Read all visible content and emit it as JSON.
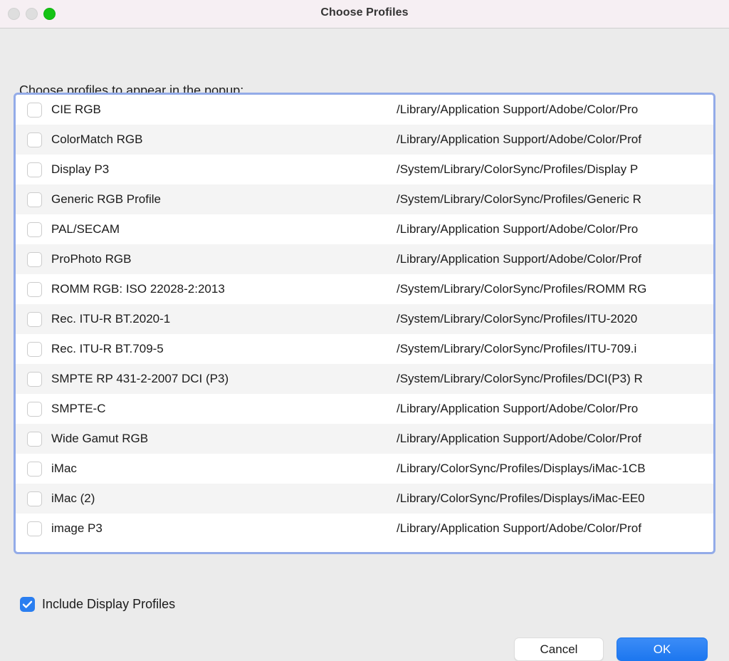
{
  "window": {
    "title": "Choose Profiles",
    "traffic_lights": [
      {
        "name": "close-button",
        "color": "#dedede"
      },
      {
        "name": "minimize-button",
        "color": "#dedede"
      },
      {
        "name": "zoom-button",
        "color": "#14c314"
      }
    ]
  },
  "prompt": "Choose profiles to appear in the popup:",
  "list": {
    "focus_ring_color": "#93abe8",
    "rows": [
      {
        "checked": false,
        "name": "CIE RGB",
        "path": "/Library/Application Support/Adobe/Color/Pro"
      },
      {
        "checked": false,
        "name": "ColorMatch RGB",
        "path": "/Library/Application Support/Adobe/Color/Prof"
      },
      {
        "checked": false,
        "name": "Display P3",
        "path": "/System/Library/ColorSync/Profiles/Display P"
      },
      {
        "checked": false,
        "name": "Generic RGB Profile",
        "path": "/System/Library/ColorSync/Profiles/Generic R"
      },
      {
        "checked": false,
        "name": "PAL/SECAM",
        "path": "/Library/Application Support/Adobe/Color/Pro"
      },
      {
        "checked": false,
        "name": "ProPhoto RGB",
        "path": "/Library/Application Support/Adobe/Color/Prof"
      },
      {
        "checked": false,
        "name": "ROMM RGB: ISO 22028-2:2013",
        "path": "/System/Library/ColorSync/Profiles/ROMM RG"
      },
      {
        "checked": false,
        "name": "Rec. ITU-R BT.2020-1",
        "path": "/System/Library/ColorSync/Profiles/ITU-2020"
      },
      {
        "checked": false,
        "name": "Rec. ITU-R BT.709-5",
        "path": "/System/Library/ColorSync/Profiles/ITU-709.i"
      },
      {
        "checked": false,
        "name": "SMPTE RP 431-2-2007 DCI (P3)",
        "path": "/System/Library/ColorSync/Profiles/DCI(P3) R"
      },
      {
        "checked": false,
        "name": "SMPTE-C",
        "path": "/Library/Application Support/Adobe/Color/Pro"
      },
      {
        "checked": false,
        "name": "Wide Gamut RGB",
        "path": "/Library/Application Support/Adobe/Color/Prof"
      },
      {
        "checked": false,
        "name": "iMac",
        "path": "/Library/ColorSync/Profiles/Displays/iMac-1CB"
      },
      {
        "checked": false,
        "name": "iMac (2)",
        "path": "/Library/ColorSync/Profiles/Displays/iMac-EE0"
      },
      {
        "checked": false,
        "name": "image P3",
        "path": "/Library/Application Support/Adobe/Color/Prof"
      }
    ]
  },
  "include_display_profiles": {
    "label": "Include Display Profiles",
    "checked": true,
    "accent_color": "#2a7ef0"
  },
  "buttons": {
    "cancel": "Cancel",
    "ok": "OK",
    "ok_color": "#2a7ef0"
  }
}
